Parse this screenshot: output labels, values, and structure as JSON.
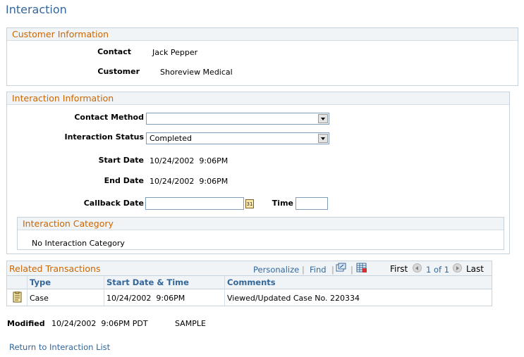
{
  "page": {
    "title": "Interaction"
  },
  "customer_info": {
    "header": "Customer Information",
    "contact_label": "Contact",
    "contact_value": "Jack Pepper",
    "customer_label": "Customer",
    "customer_value": "Shoreview Medical"
  },
  "interaction_info": {
    "header": "Interaction Information",
    "contact_method_label": "Contact Method",
    "contact_method_value": "",
    "status_label": "Interaction Status",
    "status_value": "Completed",
    "start_label": "Start Date",
    "start_value": "10/24/2002  9:06PM",
    "end_label": "End Date",
    "end_value": "10/24/2002  9:06PM",
    "callback_label": "Callback Date",
    "callback_value": "",
    "time_label": "Time",
    "time_value": "",
    "calendar_icon_text": "31",
    "category": {
      "header": "Interaction Category",
      "empty_text": "No Interaction Category"
    }
  },
  "related": {
    "header": "Related Transactions",
    "personalize": "Personalize",
    "separator": "|",
    "find": "Find",
    "first": "First",
    "range": "1 of 1",
    "last": "Last",
    "columns": [
      "Type",
      "Start Date & Time",
      "Comments"
    ],
    "rows": [
      {
        "type": "Case",
        "start": "10/24/2002  9:06PM",
        "comments": "Viewed/Updated Case No. 220334"
      }
    ]
  },
  "footer": {
    "modified_label": "Modified",
    "modified_value": "10/24/2002  9:06PM PDT",
    "modified_by": "SAMPLE",
    "return_link": "Return to Interaction List"
  },
  "colors": {
    "title": "#336699",
    "section_header": "#cc6600",
    "link": "#336699",
    "border": "#c7d3dc"
  }
}
